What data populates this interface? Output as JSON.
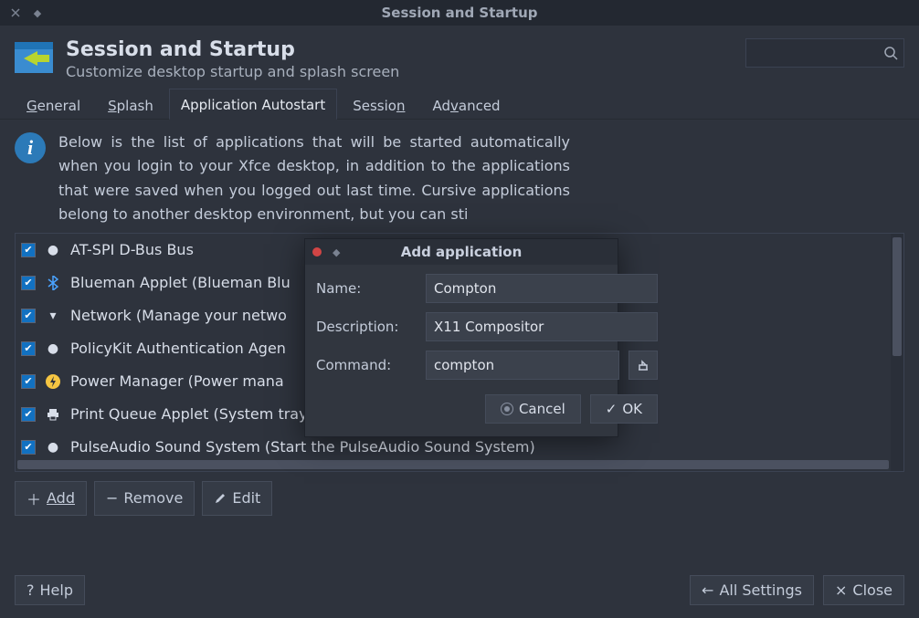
{
  "window": {
    "title": "Session and Startup"
  },
  "header": {
    "title": "Session and Startup",
    "subtitle": "Customize desktop startup and splash screen"
  },
  "tabs": [
    {
      "label": "General",
      "active": false,
      "accel": "G"
    },
    {
      "label": "Splash",
      "active": false,
      "accel": "S"
    },
    {
      "label": "Application Autostart",
      "active": true
    },
    {
      "label": "Session",
      "active": false,
      "accel": "n"
    },
    {
      "label": "Advanced",
      "active": false,
      "accel": "v"
    }
  ],
  "intro": "Below is the list of applications that will be started automatically when you login to your Xfce desktop, in addition to the applications that were saved when you logged out last time. Cursive applications belong to another desktop environment, but you can sti",
  "apps": [
    {
      "checked": true,
      "icon": "dot",
      "label": "AT-SPI D-Bus Bus"
    },
    {
      "checked": true,
      "icon": "bluetooth",
      "label": "Blueman Applet (Blueman Blu"
    },
    {
      "checked": true,
      "icon": "network",
      "label": "Network (Manage your netwo"
    },
    {
      "checked": true,
      "icon": "dot",
      "label": "PolicyKit Authentication Agen"
    },
    {
      "checked": true,
      "icon": "power",
      "label": "Power Manager (Power mana"
    },
    {
      "checked": true,
      "icon": "printer",
      "label": "Print Queue Applet (System tray icon for managing print jobs)"
    },
    {
      "checked": true,
      "icon": "dot",
      "label": "PulseAudio Sound System (Start the PulseAudio Sound System)"
    }
  ],
  "toolbar": {
    "add": "Add",
    "remove": "Remove",
    "edit": "Edit"
  },
  "footer": {
    "help": "Help",
    "all_settings": "All Settings",
    "close": "Close"
  },
  "dialog": {
    "title": "Add application",
    "name_label": "Name:",
    "desc_label": "Description:",
    "cmd_label": "Command:",
    "name_value": "Compton",
    "desc_value": "X11 Compositor",
    "cmd_value": "compton",
    "cancel": "Cancel",
    "ok": "OK"
  }
}
